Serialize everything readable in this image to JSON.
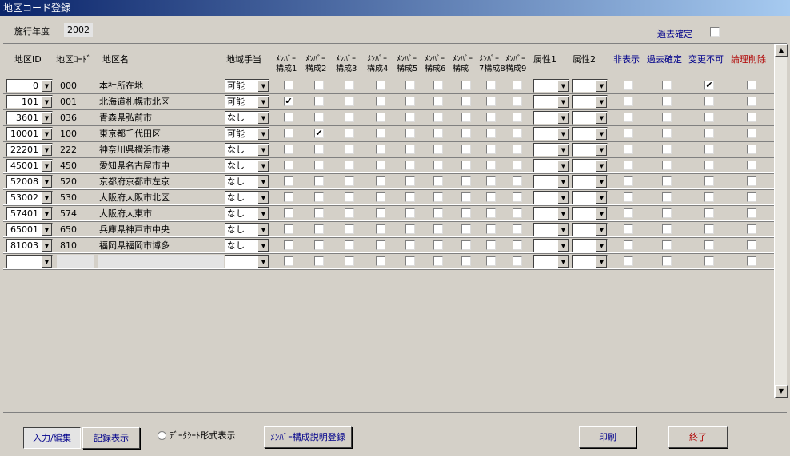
{
  "window": {
    "title": "地区コード登録"
  },
  "top": {
    "year_label": "施行年度",
    "year_value": "2002",
    "past_confirm_label": "過去確定"
  },
  "columns": {
    "area_id": "地区ID",
    "area_code": "地区ｺｰﾄﾞ",
    "area_name": "地区名",
    "allowance": "地域手当",
    "members": [
      [
        "ﾒﾝﾊﾞｰ",
        "構成1"
      ],
      [
        "ﾒﾝﾊﾞｰ",
        "構成2"
      ],
      [
        "ﾒﾝﾊﾞｰ",
        "構成3"
      ],
      [
        "ﾒﾝﾊﾞｰ",
        "構成4"
      ],
      [
        "ﾒﾝﾊﾞｰ",
        "構成5"
      ],
      [
        "ﾒﾝﾊﾞｰ",
        "構成6"
      ],
      [
        "ﾒﾝﾊﾞｰ",
        "構成"
      ],
      [
        "ﾒﾝﾊﾞｰ",
        "7構成8"
      ],
      [
        "ﾒﾝﾊﾞｰ",
        "構成9"
      ]
    ],
    "attr1": "属性1",
    "attr2": "属性2",
    "hidden": "非表示",
    "past_confirm": "過去確定",
    "no_change": "変更不可",
    "logical_delete": "論理削除"
  },
  "rows": [
    {
      "id": "0",
      "code": "000",
      "name": "本社所在地",
      "allowance": "可能",
      "members": [
        false,
        false,
        false,
        false,
        false,
        false,
        false,
        false,
        false
      ],
      "hidden": false,
      "past": false,
      "nochange": true,
      "deleted": false
    },
    {
      "id": "101",
      "code": "001",
      "name": "北海道札幌市北区",
      "allowance": "可能",
      "members": [
        true,
        false,
        false,
        false,
        false,
        false,
        false,
        false,
        false
      ],
      "hidden": false,
      "past": false,
      "nochange": false,
      "deleted": false
    },
    {
      "id": "3601",
      "code": "036",
      "name": "青森県弘前市",
      "allowance": "なし",
      "members": [
        false,
        false,
        false,
        false,
        false,
        false,
        false,
        false,
        false
      ],
      "hidden": false,
      "past": false,
      "nochange": false,
      "deleted": false
    },
    {
      "id": "10001",
      "code": "100",
      "name": "東京都千代田区",
      "allowance": "可能",
      "members": [
        false,
        true,
        false,
        false,
        false,
        false,
        false,
        false,
        false
      ],
      "hidden": false,
      "past": false,
      "nochange": false,
      "deleted": false
    },
    {
      "id": "22201",
      "code": "222",
      "name": "神奈川県横浜市港",
      "allowance": "なし",
      "members": [
        false,
        false,
        false,
        false,
        false,
        false,
        false,
        false,
        false
      ],
      "hidden": false,
      "past": false,
      "nochange": false,
      "deleted": false
    },
    {
      "id": "45001",
      "code": "450",
      "name": "愛知県名古屋市中",
      "allowance": "なし",
      "members": [
        false,
        false,
        false,
        false,
        false,
        false,
        false,
        false,
        false
      ],
      "hidden": false,
      "past": false,
      "nochange": false,
      "deleted": false
    },
    {
      "id": "52008",
      "code": "520",
      "name": "京都府京都市左京",
      "allowance": "なし",
      "members": [
        false,
        false,
        false,
        false,
        false,
        false,
        false,
        false,
        false
      ],
      "hidden": false,
      "past": false,
      "nochange": false,
      "deleted": false
    },
    {
      "id": "53002",
      "code": "530",
      "name": "大阪府大阪市北区",
      "allowance": "なし",
      "members": [
        false,
        false,
        false,
        false,
        false,
        false,
        false,
        false,
        false
      ],
      "hidden": false,
      "past": false,
      "nochange": false,
      "deleted": false
    },
    {
      "id": "57401",
      "code": "574",
      "name": "大阪府大東市",
      "allowance": "なし",
      "members": [
        false,
        false,
        false,
        false,
        false,
        false,
        false,
        false,
        false
      ],
      "hidden": false,
      "past": false,
      "nochange": false,
      "deleted": false
    },
    {
      "id": "65001",
      "code": "650",
      "name": "兵庫県神戸市中央",
      "allowance": "なし",
      "members": [
        false,
        false,
        false,
        false,
        false,
        false,
        false,
        false,
        false
      ],
      "hidden": false,
      "past": false,
      "nochange": false,
      "deleted": false
    },
    {
      "id": "81003",
      "code": "810",
      "name": "福岡県福岡市博多",
      "allowance": "なし",
      "members": [
        false,
        false,
        false,
        false,
        false,
        false,
        false,
        false,
        false
      ],
      "hidden": false,
      "past": false,
      "nochange": false,
      "deleted": false
    },
    {
      "id": "",
      "code": "",
      "name": "",
      "allowance": "",
      "members": [
        false,
        false,
        false,
        false,
        false,
        false,
        false,
        false,
        false
      ],
      "hidden": false,
      "past": false,
      "nochange": false,
      "deleted": false,
      "new_row": true
    }
  ],
  "bottom": {
    "input_edit": "入力/編集",
    "record_view": "記録表示",
    "datasheet_view": "ﾃﾞｰﾀｼｰﾄ形式表示",
    "member_desc": "ﾒﾝﾊﾞｰ構成説明登録",
    "print": "印刷",
    "exit": "終了"
  },
  "colors": {
    "titlebar": "#0a246a",
    "header_blue": "#00008b",
    "header_red": "#b00000",
    "window_bg": "#d4d0c8"
  },
  "icons": {
    "dropdown": "chevron-down-icon",
    "check": "checkmark-icon",
    "scroll_up": "arrow-up-icon",
    "scroll_down": "arrow-down-icon"
  }
}
